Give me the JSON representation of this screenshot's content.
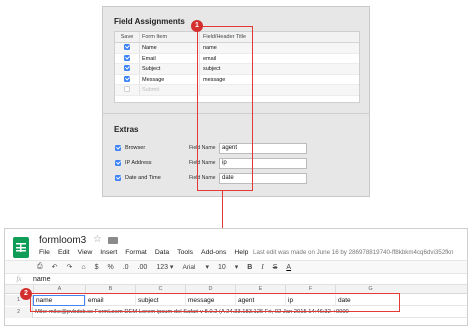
{
  "field_assignments": {
    "title": "Field Assignments",
    "columns": [
      "Save",
      "Form Item",
      "Field/Header Title"
    ],
    "rows": [
      {
        "checked": true,
        "item": "Name",
        "field": "name"
      },
      {
        "checked": true,
        "item": "Email",
        "field": "email"
      },
      {
        "checked": true,
        "item": "Subject",
        "field": "subject"
      },
      {
        "checked": true,
        "item": "Message",
        "field": "message"
      },
      {
        "checked": false,
        "item": "Submit",
        "field": ""
      }
    ]
  },
  "extras": {
    "title": "Extras",
    "field_name_label": "Field Name",
    "rows": [
      {
        "checked": true,
        "label": "Browser",
        "value": "agent"
      },
      {
        "checked": true,
        "label": "IP Address",
        "value": "ip"
      },
      {
        "checked": true,
        "label": "Date and Time",
        "value": "date"
      }
    ]
  },
  "callouts": {
    "one": "1",
    "two": "2"
  },
  "sheet": {
    "doc_title": "formloom3",
    "menu": [
      "File",
      "Edit",
      "View",
      "Insert",
      "Format",
      "Data",
      "Tools",
      "Add-ons",
      "Help"
    ],
    "last_edit": "Last edit was made on June 16 by 286978819740-ff8kbkm4cq6dvi352fkn",
    "toolbar": {
      "print": "⎙",
      "undo": "↶",
      "redo": "↷",
      "paint": "⌂",
      "currency": "$",
      "percent": "%",
      "dec_less": ".0",
      "dec_more": ".00",
      "format": "123 ▾",
      "font": "Arial",
      "font_dd": "▾",
      "size": "10",
      "size_dd": "▾",
      "bold": "B",
      "italic": "I",
      "strike": "S",
      "text_color": "A"
    },
    "fx_label": "fx",
    "fx_value": "name",
    "col_headers": [
      "A",
      "B",
      "C",
      "D",
      "E",
      "F",
      "G"
    ],
    "row_numbers": [
      "1",
      "2"
    ],
    "header_row": [
      "name",
      "email",
      "subject",
      "message",
      "agent",
      "ip",
      "date"
    ],
    "data_row_text": "Mike    mike@pvbdsb.ss FormLoom DEM Lorem ipsum dol Safari v 8.0.2 (A 24.33.183.125    Fri, 02 Jan 2015 14:46:32 +0000"
  }
}
